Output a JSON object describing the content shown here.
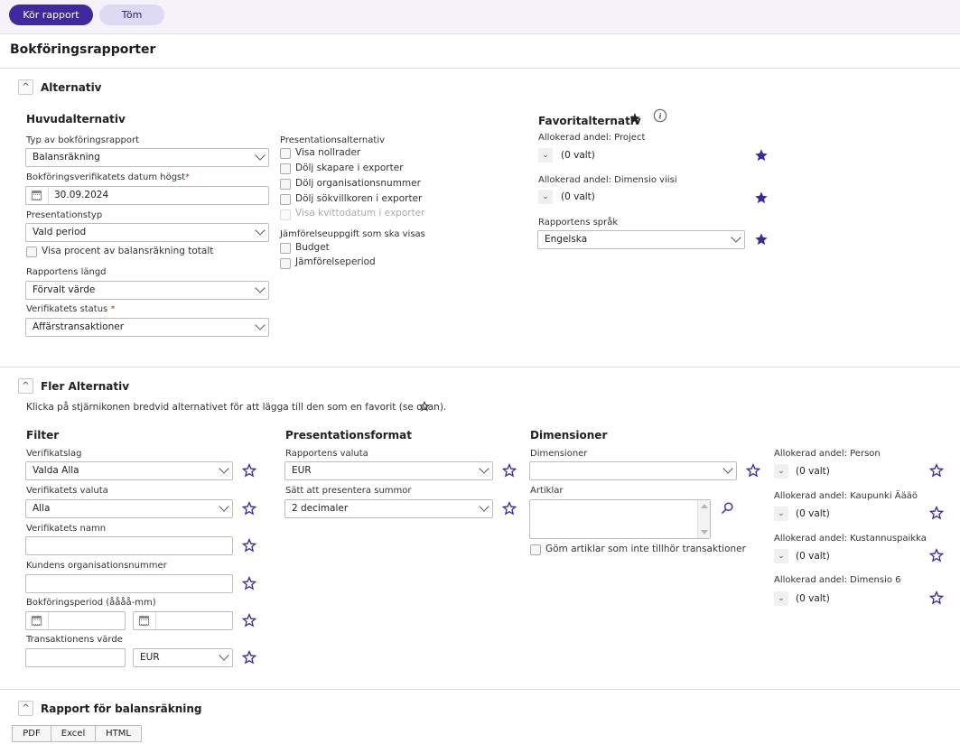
{
  "toolbar": {
    "run_label": "Kör rapport",
    "clear_label": "Töm"
  },
  "page_title": "Bokföringsrapporter",
  "sections": {
    "alternativ": "Alternativ",
    "fler": "Fler Alternativ",
    "rapport": "Rapport för balansräkning"
  },
  "main": {
    "heading": "Huvudalternativ",
    "report_type_label": "Typ av bokföringsrapport",
    "report_type_value": "Balansräkning",
    "date_label": "Bokföringsverifikatets datum högst",
    "required_mark": "*",
    "date_value": "30.09.2024",
    "pres_type_label": "Presentationstyp",
    "pres_type_value": "Vald period",
    "show_percent_label": "Visa procent av balansräkning totalt",
    "length_label": "Rapportens längd",
    "length_value": "Förvalt värde",
    "status_label": "Verifikatets status",
    "status_value": "Affärstransaktioner"
  },
  "presentation": {
    "heading": "Presentationsalternativ",
    "options": [
      "Visa nollrader",
      "Dölj skapare i exporter",
      "Dölj organisationsnummer",
      "Dölj sökvillkoren i exporter",
      "Visa kvittodatum i exporter"
    ],
    "compare_heading": "Jämförelseuppgift som ska visas",
    "compare_options": [
      "Budget",
      "Jämförelseperiod"
    ]
  },
  "favorites": {
    "heading": "Favoritalternativ",
    "project_label": "Allokerad andel: Project",
    "dimensio_label": "Allokerad andel: Dimensio viisi",
    "none_selected": "(0 valt)",
    "language_label": "Rapportens språk",
    "language_value": "Engelska"
  },
  "more": {
    "hint": "Klicka på stjärnikonen bredvid alternativet för att lägga till den som en favorit (se ovan).",
    "filter": {
      "heading": "Filter",
      "verifikatslag_label": "Verifikatslag",
      "verifikatslag_value": "Valda Alla",
      "currency_label": "Verifikatets valuta",
      "currency_value": "Alla",
      "name_label": "Verifikatets namn",
      "org_label": "Kundens organisationsnummer",
      "period_label": "Bokföringsperiod (åååå-mm)",
      "trans_value_label": "Transaktionens värde",
      "trans_currency": "EUR"
    },
    "format": {
      "heading": "Presentationsformat",
      "currency_label": "Rapportens valuta",
      "currency_value": "EUR",
      "sum_label": "Sätt att presentera summor",
      "sum_value": "2 decimaler"
    },
    "dimensions": {
      "heading": "Dimensioner",
      "dim_label": "Dimensioner",
      "articles_label": "Artiklar",
      "hide_articles_label": "Göm artiklar som inte tillhör transaktioner"
    },
    "alloc": {
      "person": "Allokerad andel: Person",
      "kaupunki": "Allokerad andel: Kaupunki Äääö",
      "kustannus": "Allokerad andel: Kustannuspaikka",
      "dimensio6": "Allokerad andel: Dimensio 6",
      "none_selected": "(0 valt)"
    }
  },
  "export": {
    "pdf": "PDF",
    "excel": "Excel",
    "html": "HTML"
  },
  "colors": {
    "accent": "#3e2a9c",
    "star": "#3a2a9e"
  }
}
